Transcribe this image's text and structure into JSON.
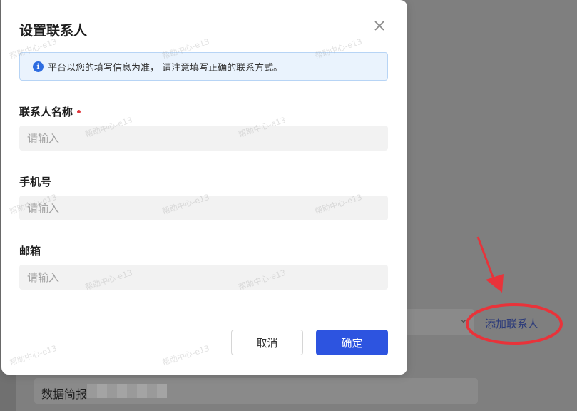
{
  "dialog": {
    "title": "设置联系人",
    "notice": "平台以您的填写信息为准， 请注意填写正确的联系方式。",
    "fields": [
      {
        "label": "联系人名称",
        "required_mark": "•",
        "placeholder": "请输入"
      },
      {
        "label": "手机号",
        "placeholder": "请输入"
      },
      {
        "label": "邮箱",
        "placeholder": "请输入"
      }
    ],
    "cancel_label": "取消",
    "confirm_label": "确定"
  },
  "background": {
    "add_contact_link": "添加联系人",
    "report_label": "数据简报",
    "chevron": "⌄"
  },
  "watermark": "帮助中心-e13",
  "colors": {
    "primary": "#2d54e0",
    "notice_bg": "#eaf3fd",
    "required": "#e0383e",
    "annotation": "#e8333a"
  },
  "icons": [
    "close-icon",
    "info-icon",
    "chevron-down-icon",
    "annotation-arrow"
  ]
}
